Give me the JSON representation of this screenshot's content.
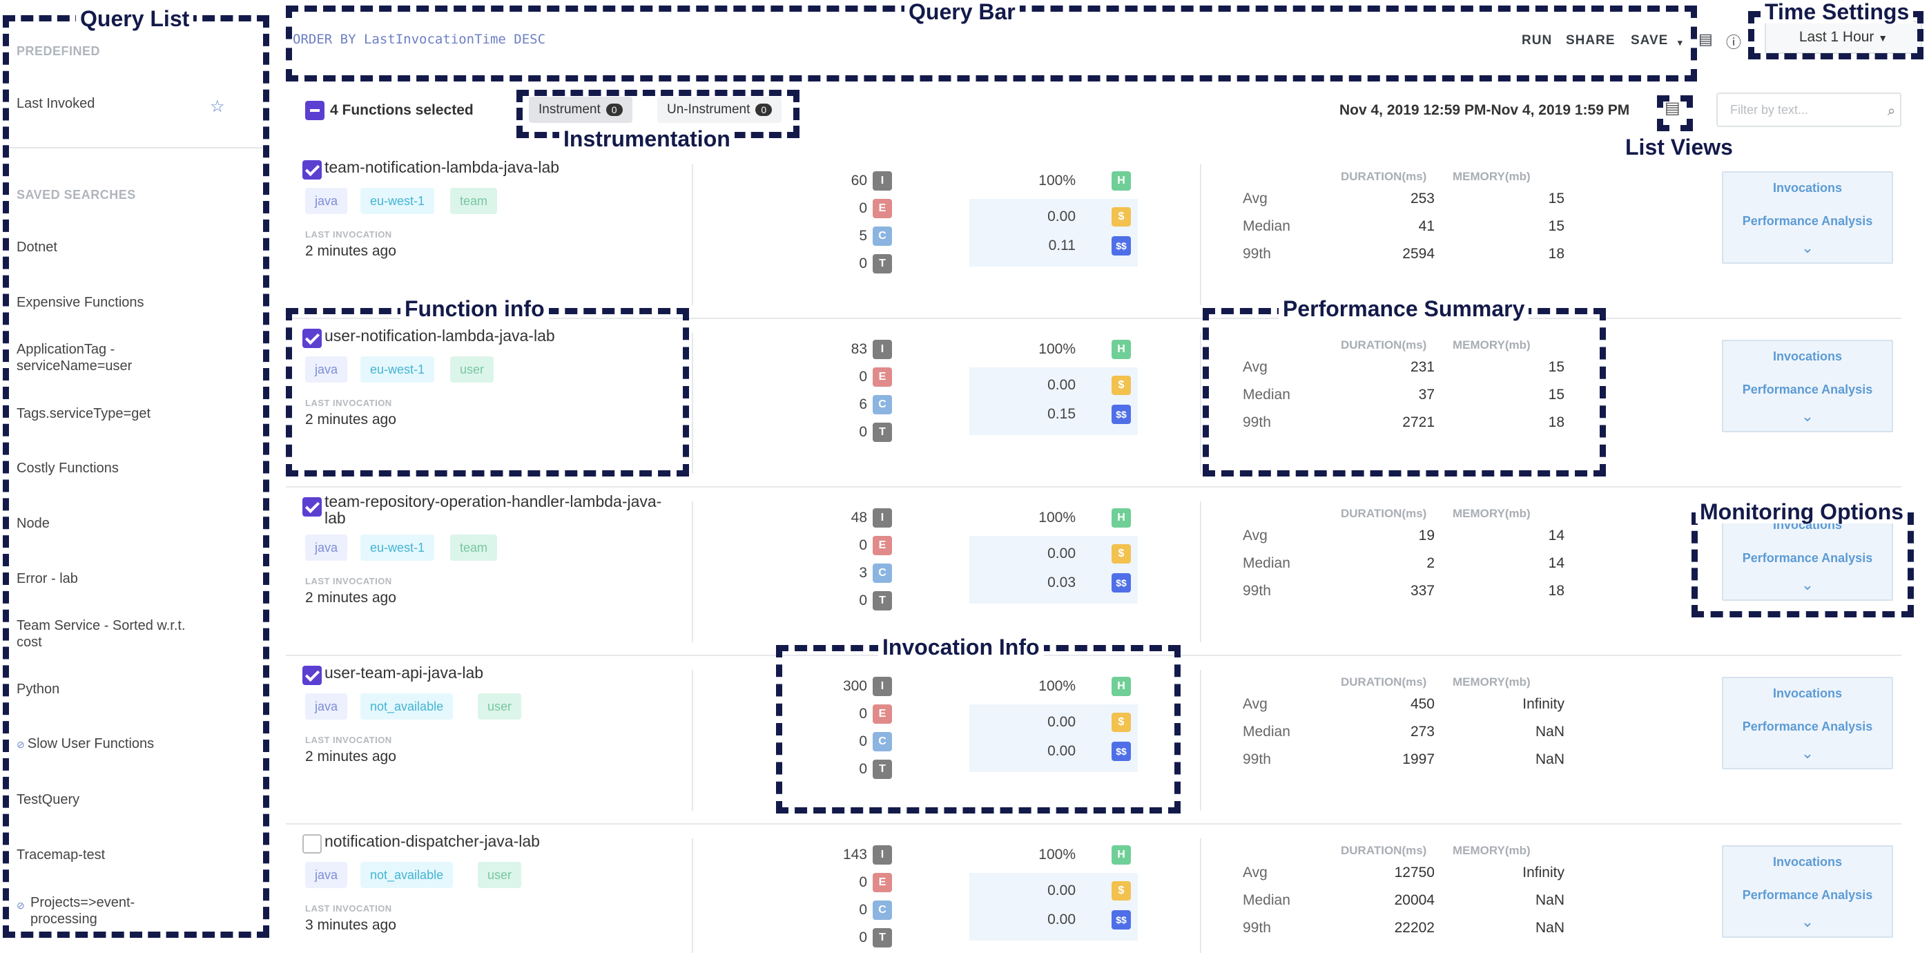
{
  "sidebar": {
    "predefined_label": "PREDEFINED",
    "last_invoked": "Last Invoked",
    "saved_searches_label": "SAVED SEARCHES",
    "saved_searches": [
      "Dotnet",
      "Expensive Functions",
      "ApplicationTag - serviceName=user",
      "Tags.serviceType=get",
      "Costly Functions",
      "Node",
      "Error - lab",
      "Team Service - Sorted w.r.t. cost",
      "Python",
      "Slow User Functions",
      "TestQuery",
      "Tracemap-test",
      "Projects=>event-processing"
    ]
  },
  "query_bar": {
    "query": "ORDER BY LastInvocationTime DESC",
    "run": "RUN",
    "share": "SHARE",
    "save": "SAVE",
    "time_range": "Last 1 Hour"
  },
  "list_header": {
    "selected": "4 Functions selected",
    "instrument": "Instrument",
    "instrument_count": "0",
    "uninstrument": "Un-Instrument",
    "uninstrument_count": "0",
    "date_range": "Nov 4, 2019 12:59 PM-Nov 4, 2019 1:59 PM",
    "filter_placeholder": "Filter by text..."
  },
  "column_labels": {
    "last_invocation": "LAST INVOCATION",
    "duration": "DURATION(ms)",
    "memory": "MEMORY(mb)",
    "avg": "Avg",
    "median": "Median",
    "p99": "99th",
    "invocations": "Invocations",
    "performance_analysis": "Performance Analysis"
  },
  "badges": {
    "i": "I",
    "e": "E",
    "c": "C",
    "t": "T",
    "h": "H",
    "s": "$",
    "ss": "$$"
  },
  "functions": [
    {
      "name": "team-notification-lambda-java-lab",
      "checked": true,
      "tags": [
        "java",
        "eu-west-1",
        "team"
      ],
      "last_invocation": "2 minutes ago",
      "invocations": "60",
      "errors": "0",
      "cold_starts": "5",
      "timeouts": "0",
      "health": "100%",
      "cost": "0.00",
      "cost2": "0.11",
      "avg_duration": "253",
      "avg_memory": "15",
      "median_duration": "41",
      "median_memory": "15",
      "p99_duration": "2594",
      "p99_memory": "18"
    },
    {
      "name": "user-notification-lambda-java-lab",
      "checked": true,
      "tags": [
        "java",
        "eu-west-1",
        "user"
      ],
      "last_invocation": "2 minutes ago",
      "invocations": "83",
      "errors": "0",
      "cold_starts": "6",
      "timeouts": "0",
      "health": "100%",
      "cost": "0.00",
      "cost2": "0.15",
      "avg_duration": "231",
      "avg_memory": "15",
      "median_duration": "37",
      "median_memory": "15",
      "p99_duration": "2721",
      "p99_memory": "18"
    },
    {
      "name": "team-repository-operation-handler-lambda-java-lab",
      "checked": true,
      "tags": [
        "java",
        "eu-west-1",
        "team"
      ],
      "last_invocation": "2 minutes ago",
      "invocations": "48",
      "errors": "0",
      "cold_starts": "3",
      "timeouts": "0",
      "health": "100%",
      "cost": "0.00",
      "cost2": "0.03",
      "avg_duration": "19",
      "avg_memory": "14",
      "median_duration": "2",
      "median_memory": "14",
      "p99_duration": "337",
      "p99_memory": "18"
    },
    {
      "name": "user-team-api-java-lab",
      "checked": true,
      "tags": [
        "java",
        "not_available",
        "user"
      ],
      "last_invocation": "2 minutes ago",
      "invocations": "300",
      "errors": "0",
      "cold_starts": "0",
      "timeouts": "0",
      "health": "100%",
      "cost": "0.00",
      "cost2": "0.00",
      "avg_duration": "450",
      "avg_memory": "Infinity",
      "median_duration": "273",
      "median_memory": "NaN",
      "p99_duration": "1997",
      "p99_memory": "NaN"
    },
    {
      "name": "notification-dispatcher-java-lab",
      "checked": false,
      "tags": [
        "java",
        "not_available",
        "user"
      ],
      "last_invocation": "3 minutes ago",
      "invocations": "143",
      "errors": "0",
      "cold_starts": "0",
      "timeouts": "0",
      "health": "100%",
      "cost": "0.00",
      "cost2": "0.00",
      "avg_duration": "12750",
      "avg_memory": "Infinity",
      "median_duration": "20004",
      "median_memory": "NaN",
      "p99_duration": "22202",
      "p99_memory": "NaN"
    }
  ],
  "annotations": {
    "query_list": "Query List",
    "query_bar": "Query Bar",
    "time_settings": "Time Settings",
    "instrumentation": "Instrumentation",
    "list_views": "List Views",
    "function_info": "Function info",
    "performance_summary": "Performance Summary",
    "monitoring_options": "Monitoring Options",
    "invocation_info": "Invocation Info"
  },
  "colors": {
    "accent": "#5b3fd1",
    "annotation": "#131a4a",
    "link": "#5b9bd5"
  },
  "icons": {
    "star": "star-icon",
    "search": "search-icon",
    "list_view": "list-view-icon",
    "info": "info-icon",
    "comment": "comment-icon",
    "chevron": "chevron-down-icon"
  }
}
